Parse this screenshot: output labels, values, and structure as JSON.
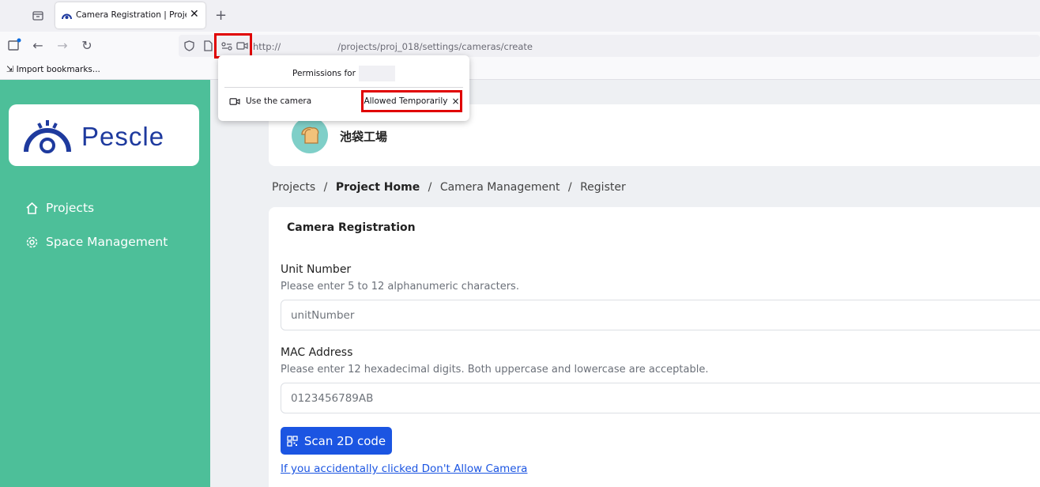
{
  "browser": {
    "tab_title": "Camera Registration | Project M",
    "new_tab": "+",
    "url_prefix": "http://",
    "url_path": "/projects/proj_018/settings/cameras/create",
    "bookmark_item": "Import bookmarks..."
  },
  "permissions_popup": {
    "title": "Permissions for",
    "camera_label": "Use the camera",
    "camera_status": "Allowed Temporarily",
    "close_glyph": "×"
  },
  "sidebar": {
    "logo_text": "Pescle",
    "items": [
      {
        "label": "Projects",
        "icon": "home-icon"
      },
      {
        "label": "Space Management",
        "icon": "gear-icon"
      }
    ]
  },
  "header": {
    "site_name": "池袋工場",
    "avatar_icon": "bread-icon"
  },
  "breadcrumb": {
    "items": [
      "Projects",
      "Project Home",
      "Camera Management",
      "Register"
    ],
    "separator": "/"
  },
  "form": {
    "title": "Camera Registration",
    "unit_number": {
      "label": "Unit Number",
      "help": "Please enter 5 to 12 alphanumeric characters.",
      "placeholder": "unitNumber"
    },
    "mac_address": {
      "label": "MAC Address",
      "help": "Please enter 12 hexadecimal digits. Both uppercase and lowercase are acceptable.",
      "placeholder": "0123456789AB"
    },
    "scan_button": "Scan 2D code",
    "help_link": "If you accidentally clicked Don't Allow Camera"
  },
  "colors": {
    "sidebar": "#4dbf99",
    "primary_button": "#1b55e2",
    "highlight": "#e00000",
    "logo_blue": "#1e3a9e"
  }
}
